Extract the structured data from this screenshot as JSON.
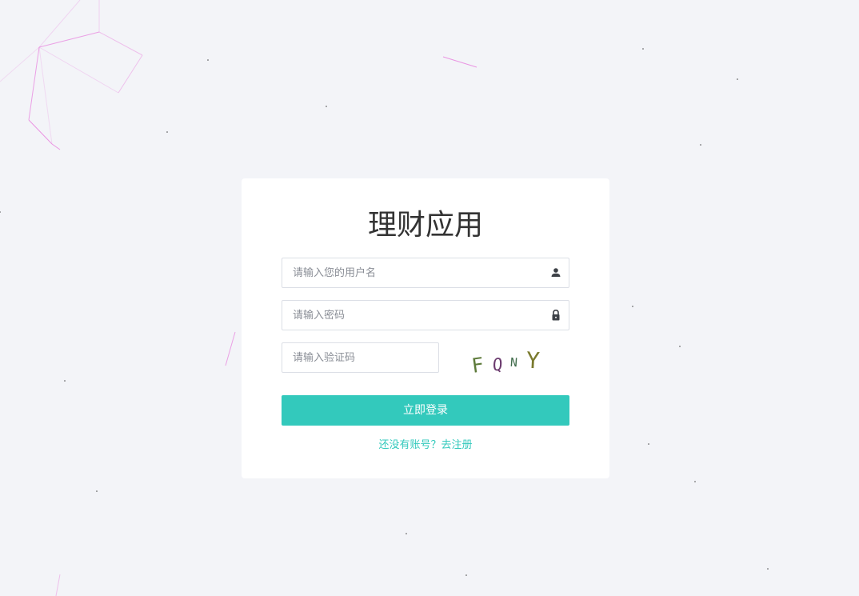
{
  "page": {
    "title": "理财应用"
  },
  "form": {
    "username": {
      "placeholder": "请输入您的用户名",
      "value": "",
      "icon": "user-icon"
    },
    "password": {
      "placeholder": "请输入密码",
      "value": "",
      "icon": "lock-icon"
    },
    "captcha": {
      "placeholder": "请输入验证码",
      "value": "",
      "code_chars": [
        "F",
        "Q",
        "N",
        "Y"
      ],
      "code_colors": [
        "#5d7a3a",
        "#6b3a6e",
        "#3f6b4a",
        "#7a7a2e"
      ]
    },
    "login_label": "立即登录",
    "register_link": "还没有账号？去注册"
  },
  "colors": {
    "page_background": "#f3f4f8",
    "card_background": "#ffffff",
    "accent": "#33c9bc",
    "title_text": "#333333",
    "particle_line": "#e98be0"
  }
}
